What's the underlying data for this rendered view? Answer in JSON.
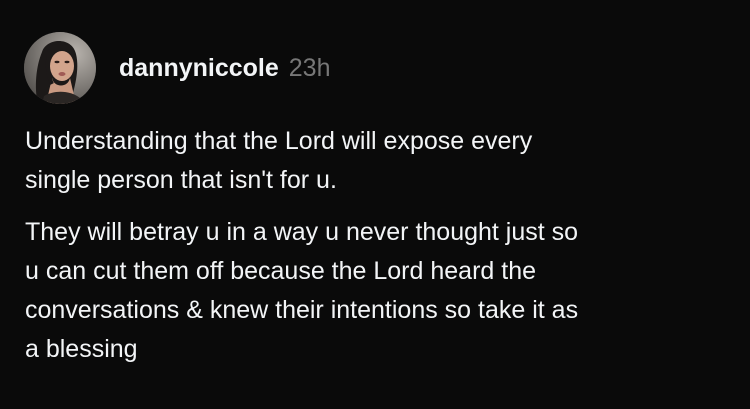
{
  "post": {
    "author": {
      "username": "dannyniccole",
      "avatar": "profile-photo"
    },
    "timestamp": "23h",
    "paragraphs": [
      "Understanding that the Lord will expose every\nsingle person that isn't for u.",
      "They will betray u in a way u never thought just so\nu can cut them off because the Lord heard the\nconversations & knew their intentions so take it as\na blessing"
    ]
  },
  "colors": {
    "background": "#0a0a0a",
    "text": "#f3f5f7",
    "muted": "#777777"
  }
}
